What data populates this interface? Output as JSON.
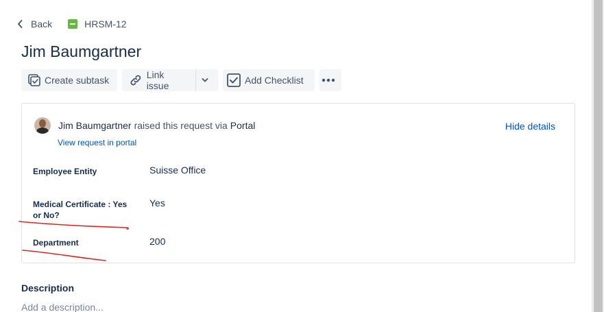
{
  "nav": {
    "back_label": "Back",
    "issue_key": "HRSM-12"
  },
  "issue": {
    "title": "Jim Baumgartner"
  },
  "toolbar": {
    "create_subtask": "Create subtask",
    "link_issue": "Link issue",
    "add_checklist": "Add Checklist"
  },
  "request": {
    "reporter_name": "Jim Baumgartner",
    "raised_text": "raised this request via",
    "channel": "Portal",
    "view_portal_link": "View request in portal",
    "hide_details": "Hide details",
    "fields": [
      {
        "label": "Employee Entity",
        "value": "Suisse Office"
      },
      {
        "label": "Medical Certificate : Yes or No?",
        "value": "Yes"
      },
      {
        "label": "Department",
        "value": "200"
      }
    ]
  },
  "description": {
    "heading": "Description",
    "placeholder": "Add a description..."
  },
  "colors": {
    "link": "#0052cc",
    "annotation": "#e2231a",
    "story_icon": "#63ba3c"
  },
  "icons": {
    "back": "chevron-left-icon",
    "issue_type": "story-icon",
    "subtask": "subtask-icon",
    "link": "link-icon",
    "dropdown": "chevron-down-icon",
    "checklist": "checkbox-icon",
    "more": "more-icon"
  }
}
